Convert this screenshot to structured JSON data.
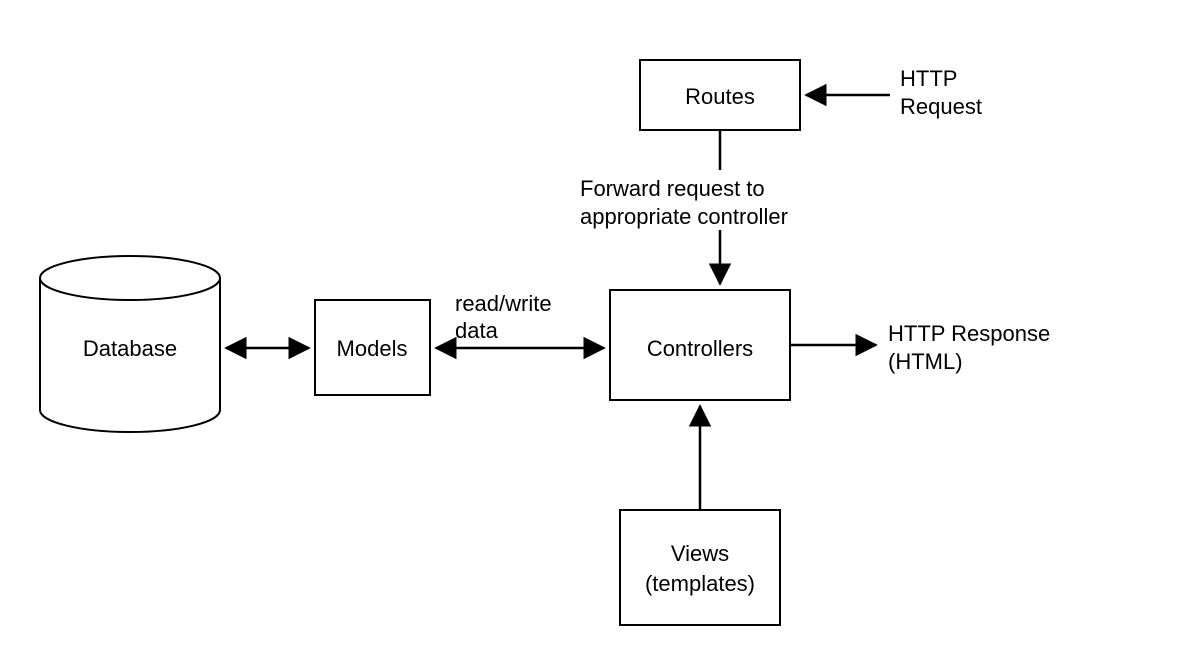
{
  "nodes": {
    "database": "Database",
    "models": "Models",
    "controllers": "Controllers",
    "routes": "Routes",
    "views_l1": "Views",
    "views_l2": "(templates)"
  },
  "edges": {
    "readwrite": "read/write",
    "data": "data",
    "forward_l1": "Forward request to",
    "forward_l2": "appropriate controller",
    "http_req_l1": "HTTP",
    "http_req_l2": "Request",
    "http_resp_l1": "HTTP Response",
    "http_resp_l2": "(HTML)"
  }
}
